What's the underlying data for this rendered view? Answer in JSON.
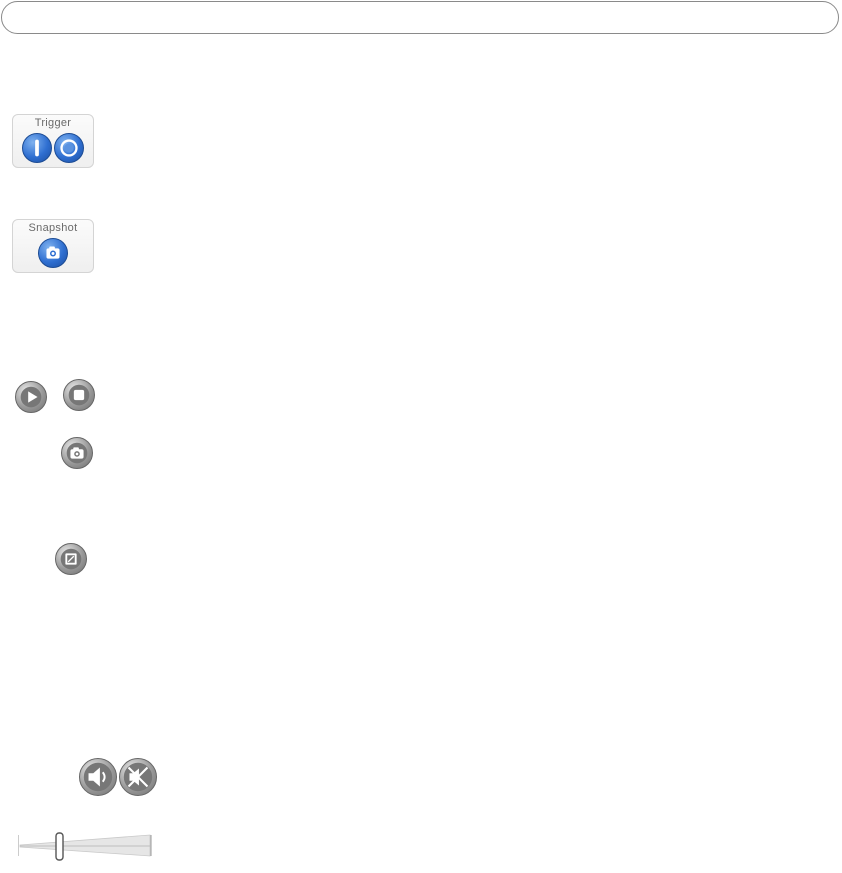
{
  "trigger_panel": {
    "title": "Trigger"
  },
  "snapshot_panel": {
    "title": "Snapshot"
  },
  "icons": {
    "trigger_on": "trigger-on-icon",
    "trigger_off": "trigger-off-icon",
    "snapshot": "camera-icon",
    "play": "play-icon",
    "stop": "stop-icon",
    "snapshot_grey": "camera-icon",
    "fullscreen": "fullscreen-icon",
    "speaker": "speaker-icon",
    "mute": "mute-icon"
  },
  "colors": {
    "button_blue": "#2f6fd1",
    "button_grey": "#9a9a9a"
  }
}
